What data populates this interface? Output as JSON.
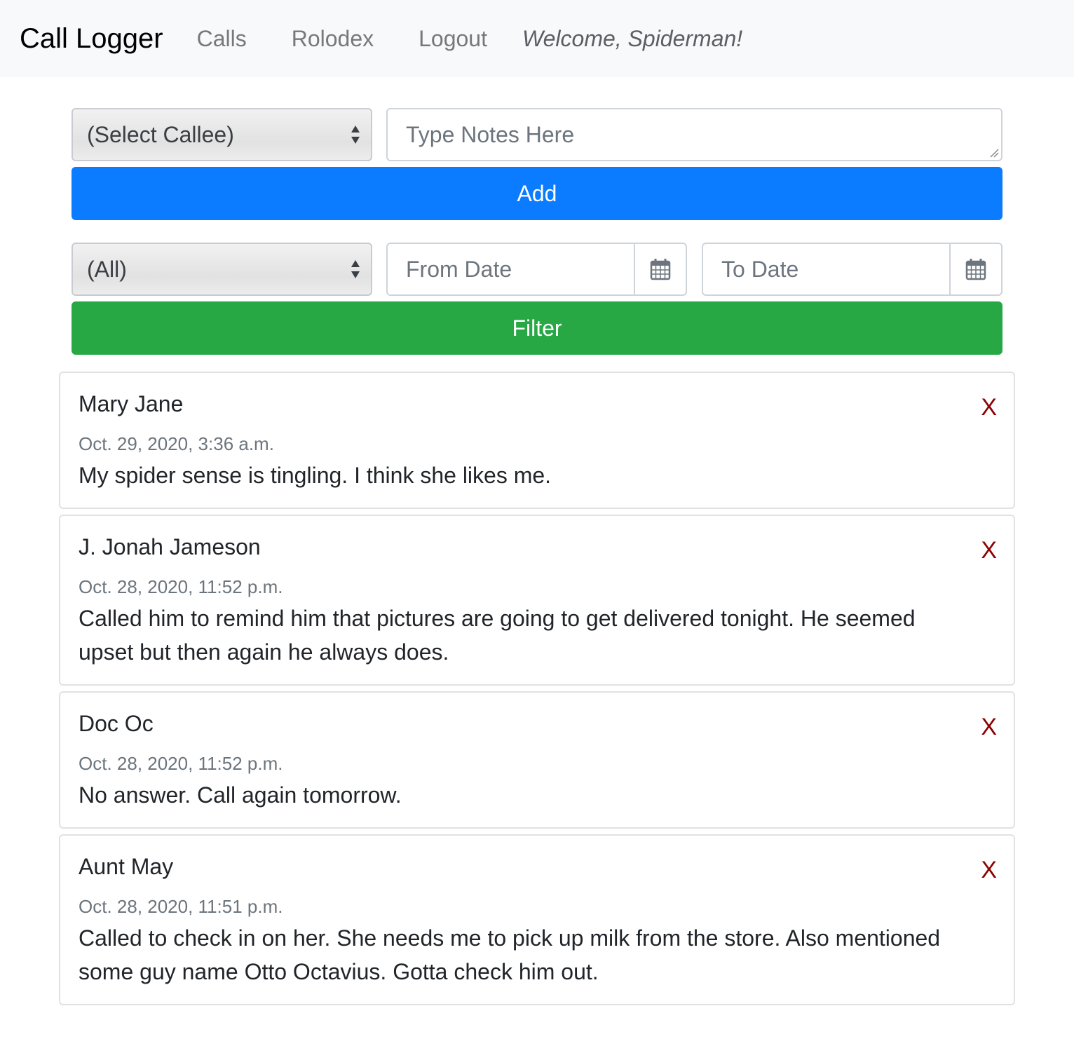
{
  "navbar": {
    "brand": "Call Logger",
    "links": [
      "Calls",
      "Rolodex",
      "Logout"
    ],
    "welcome": "Welcome, Spiderman!"
  },
  "add_form": {
    "callee_select": "(Select Callee)",
    "notes_placeholder": "Type Notes Here",
    "add_label": "Add"
  },
  "filter_form": {
    "callee_select": "(All)",
    "from_placeholder": "From Date",
    "to_placeholder": "To Date",
    "filter_label": "Filter"
  },
  "calls": [
    {
      "name": "Mary Jane",
      "date": "Oct. 29, 2020, 3:36 a.m.",
      "note": "My spider sense is tingling. I think she likes me.",
      "delete": "X"
    },
    {
      "name": "J. Jonah Jameson",
      "date": "Oct. 28, 2020, 11:52 p.m.",
      "note": "Called him to remind him that pictures are going to get delivered tonight. He seemed upset but then again he always does.",
      "delete": "X"
    },
    {
      "name": "Doc Oc",
      "date": "Oct. 28, 2020, 11:52 p.m.",
      "note": "No answer. Call again tomorrow.",
      "delete": "X"
    },
    {
      "name": "Aunt May",
      "date": "Oct. 28, 2020, 11:51 p.m.",
      "note": "Called to check in on her. She needs me to pick up milk from the store. Also mentioned some guy name Otto Octavius. Gotta check him out.",
      "delete": "X"
    }
  ],
  "colors": {
    "primary": "#0b7bff",
    "success": "#28a745",
    "delete": "#8b0000",
    "navbar_bg": "#f8f9fa"
  },
  "icons": [
    "select-arrows-icon",
    "calendar-icon",
    "resize-grip-icon"
  ]
}
